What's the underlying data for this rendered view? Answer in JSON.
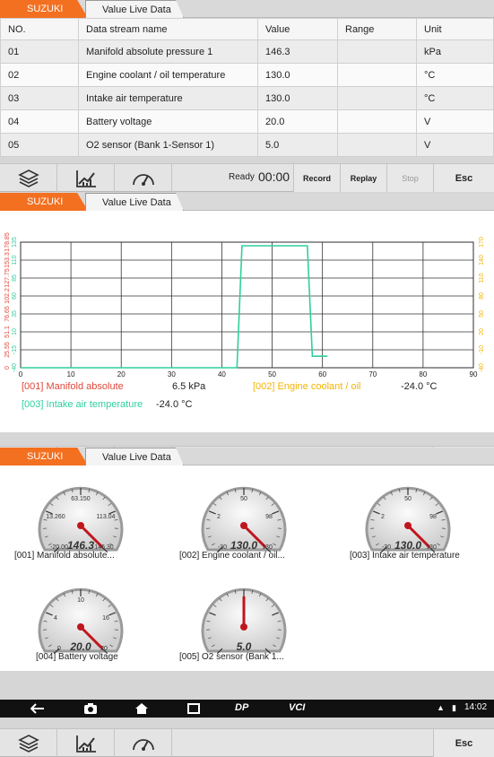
{
  "brand": "SUZUKI",
  "title": "Value Live Data",
  "table": {
    "headers": [
      "NO.",
      "Data stream name",
      "Value",
      "Range",
      "Unit"
    ],
    "rows": [
      {
        "no": "01",
        "name": "Manifold absolute pressure 1",
        "value": "146.3",
        "range": "",
        "unit": "kPa"
      },
      {
        "no": "02",
        "name": "Engine coolant / oil temperature",
        "value": "130.0",
        "range": "",
        "unit": "°C"
      },
      {
        "no": "03",
        "name": "Intake air temperature",
        "value": "130.0",
        "range": "",
        "unit": "°C"
      },
      {
        "no": "04",
        "name": "Battery voltage",
        "value": "20.0",
        "range": "",
        "unit": "V"
      },
      {
        "no": "05",
        "name": "O2 sensor (Bank 1-Sensor 1)",
        "value": "5.0",
        "range": "",
        "unit": "V"
      }
    ]
  },
  "toolbar": {
    "ready": "Ready",
    "timer": "00:00",
    "record": "Record",
    "replay": "Replay",
    "stop": "Stop",
    "esc": "Esc"
  },
  "chart_data": {
    "type": "line",
    "xlabel": "(S)",
    "xlim": [
      0,
      90
    ],
    "xticks": [
      "0",
      "10",
      "20",
      "30",
      "40",
      "50",
      "60",
      "70",
      "80",
      "90"
    ],
    "series": [
      {
        "name": "[003] Intake air temperature",
        "color": "#2fcf9f",
        "x": [
          0,
          43,
          44,
          57,
          58,
          61
        ],
        "y": [
          -40,
          -40,
          130,
          130,
          -24,
          -24
        ]
      }
    ],
    "y_left_red": [
      "0",
      "25.55",
      "51.1",
      "76.65",
      "102.2",
      "127.75",
      "153.3",
      "178.85"
    ],
    "y_left_teal": [
      "-40",
      "-15",
      "10",
      "35",
      "60",
      "85",
      "110",
      "135"
    ],
    "y_right_orange": [
      "-40",
      "-10",
      "20",
      "50",
      "80",
      "110",
      "140",
      "170"
    ],
    "grid": true
  },
  "legend": {
    "l1": "[001] Manifold absolute",
    "v1": "6.5 kPa",
    "l2": "[002] Engine coolant / oil",
    "v2": "-24.0 °C",
    "l3": "[003] Intake air temperature",
    "v3": "-24.0 °C"
  },
  "gauges": [
    {
      "label": "[001] Manifold absolute...",
      "value": "146.3",
      "ticks": [
        "63.150",
        "13.260",
        "113.04",
        "-20.00",
        "146.30"
      ],
      "fraction": 1.0
    },
    {
      "label": "[002] Engine coolant / oil...",
      "value": "130.0",
      "ticks": [
        "50",
        "2",
        "98",
        "-30",
        "130"
      ],
      "fraction": 1.0
    },
    {
      "label": "[003] Intake air temperature",
      "value": "130.0",
      "ticks": [
        "50",
        "2",
        "98",
        "-30",
        "130"
      ],
      "fraction": 1.0
    },
    {
      "label": "[004] Battery voltage",
      "value": "20.0",
      "ticks": [
        "10",
        "4",
        "16",
        "0",
        "20"
      ],
      "fraction": 1.0
    },
    {
      "label": "[005] O2 sensor (Bank 1...",
      "value": "5.0",
      "ticks": [
        "",
        "",
        "",
        "",
        ""
      ],
      "fraction": 0.5
    }
  ],
  "navbar": {
    "time": "14:02"
  },
  "colors": {
    "brand": "#f37021",
    "series_red": "#e0483a",
    "series_orange": "#f5b400",
    "series_teal": "#2fcf9f"
  }
}
